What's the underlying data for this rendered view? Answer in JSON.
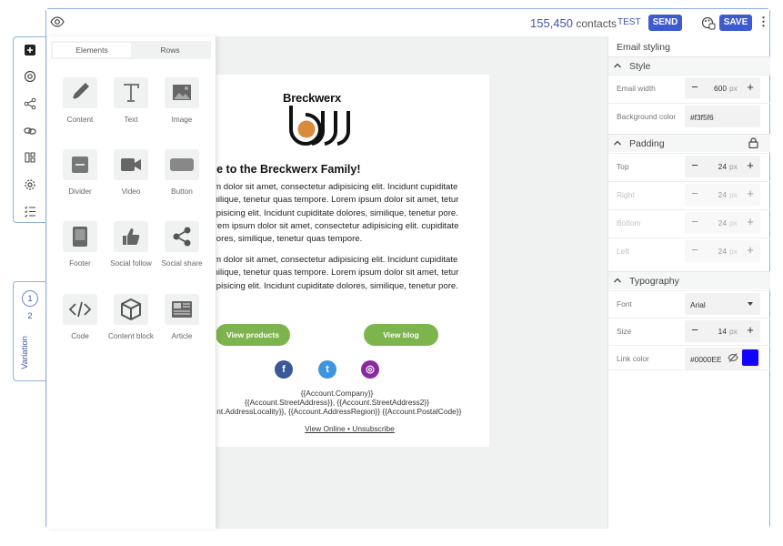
{
  "topbar": {
    "contacts_count": "155,450",
    "contacts_label": "contacts",
    "test_label": "TEST",
    "send_label": "SEND",
    "save_label": "SAVE",
    "kebab": "⋮"
  },
  "elements_panel": {
    "tabs": [
      {
        "label": "Elements",
        "active": true
      },
      {
        "label": "Rows",
        "active": false
      }
    ],
    "tiles": [
      {
        "label": "Content",
        "icon": "pencil-icon"
      },
      {
        "label": "Text",
        "icon": "text-icon"
      },
      {
        "label": "Image",
        "icon": "image-icon"
      },
      {
        "label": "Divider",
        "icon": "divider-icon"
      },
      {
        "label": "Video",
        "icon": "video-icon"
      },
      {
        "label": "Button",
        "icon": "button-icon"
      },
      {
        "label": "Footer",
        "icon": "footer-icon"
      },
      {
        "label": "Social follow",
        "icon": "thumbs-up-icon"
      },
      {
        "label": "Social share",
        "icon": "share-icon"
      },
      {
        "label": "Code",
        "icon": "code-icon"
      },
      {
        "label": "Content block",
        "icon": "cube-icon"
      },
      {
        "label": "Article",
        "icon": "article-icon"
      }
    ]
  },
  "variation": {
    "numbers": [
      "1",
      "2"
    ],
    "label": "Variation"
  },
  "email": {
    "brand": "Breckwerx",
    "heading": "me to the Breckwerx Family!",
    "paragraph1": "sum dolor sit amet, consectetur adipisicing elit. Incidunt cupiditate similique, tenetur quas tempore. Lorem ipsum dolor sit amet, tetur adipisicing elit. Incidunt cupiditate dolores, similique, tenetur pore. Lorem ipsum dolor sit amet, consectetur adipisicing elit. cupiditate dolores, similique, tenetur quas tempore.",
    "paragraph2": "sum dolor sit amet, consectetur adipisicing elit. Incidunt cupiditate similique, tenetur quas tempore. Lorem ipsum dolor sit amet, tetur adipisicing elit. Incidunt cupiditate dolores, similique, tenetur pore.",
    "button_products": "View products",
    "button_blog": "View blog",
    "address_line1": "{{Account.Company}}",
    "address_line2": "{{Account.StreetAddress}}, {{Account.StreetAddress2}}",
    "address_line3": "unt.AddressLocality}}, {{Account.AddressRegion}} {{Account.PostalCode}}",
    "footer_links": "View Online • Unsubscribe",
    "social": [
      {
        "glyph": "f",
        "color": "#3b5998"
      },
      {
        "glyph": "t",
        "color": "#3d95e0"
      },
      {
        "glyph": "◎",
        "color": "#8b2a9e"
      }
    ]
  },
  "settings": {
    "title": "Email styling",
    "style": {
      "section": "Style",
      "email_width_label": "Email width",
      "email_width": "600",
      "unit": "px",
      "background_color_label": "Background color",
      "background_color": "#f3f5f6"
    },
    "padding": {
      "section": "Padding",
      "top_label": "Top",
      "top": "24",
      "right_label": "Right",
      "right": "24",
      "bottom_label": "Bottom",
      "bottom": "24",
      "left_label": "Left",
      "left": "24"
    },
    "typography": {
      "section": "Typography",
      "font_label": "Font",
      "font": "Arial",
      "size_label": "Size",
      "size": "14",
      "link_color_label": "Link color",
      "link_color": "#0000EE"
    },
    "minus": "−",
    "plus": "+"
  },
  "colors": {
    "accent": "#3d5bcf",
    "email_button": "#7db44d",
    "link_swatch": "#1400ff"
  }
}
